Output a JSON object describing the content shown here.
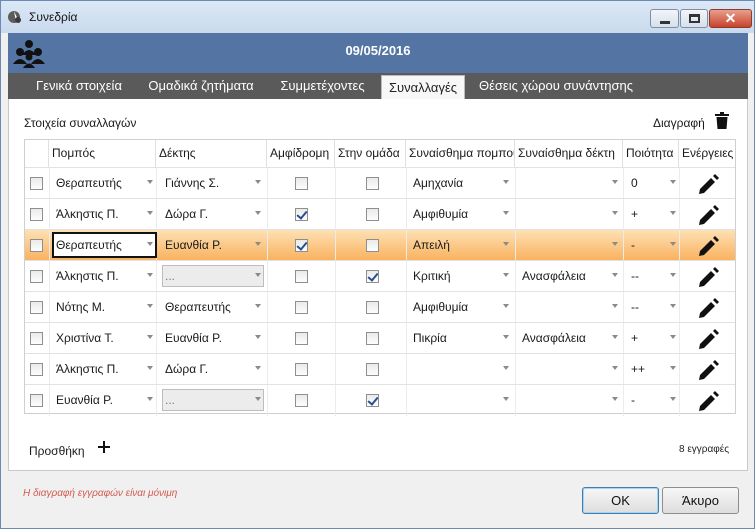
{
  "window": {
    "title": "Συνεδρία"
  },
  "header": {
    "date": "09/05/2016"
  },
  "tabs": [
    {
      "label": "Γενικά στοιχεία",
      "active": false
    },
    {
      "label": "Ομαδικά ζητήματα",
      "active": false
    },
    {
      "label": "Συμμετέχοντες",
      "active": false
    },
    {
      "label": "Συναλλαγές",
      "active": true
    },
    {
      "label": "Θέσεις χώρου συνάντησης",
      "active": false
    }
  ],
  "section": {
    "title": "Στοιχεία συναλλαγών",
    "delete_label": "Διαγραφή"
  },
  "grid": {
    "columns": [
      "Πομπός",
      "Δέκτης",
      "Αμφίδρομη",
      "Στην ομάδα",
      "Συναίσθημα πομπού",
      "Συναίσθημα δέκτη",
      "Ποιότητα",
      "Ενέργειες"
    ],
    "rows": [
      {
        "sender": "Θεραπευτής",
        "receiver": "Γιάννης Σ.",
        "bidirectional": false,
        "in_group": false,
        "sender_emotion": "Αμηχανία",
        "receiver_emotion": "",
        "quality": "0",
        "receiver_disabled": false
      },
      {
        "sender": "Άλκηστις Π.",
        "receiver": "Δώρα Γ.",
        "bidirectional": true,
        "in_group": false,
        "sender_emotion": "Αμφιθυμία",
        "receiver_emotion": "",
        "quality": "+",
        "receiver_disabled": false
      },
      {
        "sender": "Θεραπευτής",
        "receiver": "Ευανθία Ρ.",
        "bidirectional": true,
        "in_group": false,
        "sender_emotion": "Απειλή",
        "receiver_emotion": "",
        "quality": "-",
        "receiver_disabled": false
      },
      {
        "sender": "Άλκηστις Π.",
        "receiver": "...",
        "bidirectional": false,
        "in_group": true,
        "sender_emotion": "Κριτική",
        "receiver_emotion": "Ανασφάλεια",
        "quality": "--",
        "receiver_disabled": true
      },
      {
        "sender": "Νότης Μ.",
        "receiver": "Θεραπευτής",
        "bidirectional": false,
        "in_group": false,
        "sender_emotion": "Αμφιθυμία",
        "receiver_emotion": "",
        "quality": "--",
        "receiver_disabled": false
      },
      {
        "sender": "Χριστίνα Τ.",
        "receiver": "Ευανθία Ρ.",
        "bidirectional": false,
        "in_group": false,
        "sender_emotion": "Πικρία",
        "receiver_emotion": "Ανασφάλεια",
        "quality": "+",
        "receiver_disabled": false
      },
      {
        "sender": "Άλκηστις Π.",
        "receiver": "Δώρα Γ.",
        "bidirectional": false,
        "in_group": false,
        "sender_emotion": "",
        "receiver_emotion": "",
        "quality": "++",
        "receiver_disabled": false
      },
      {
        "sender": "Ευανθία Ρ.",
        "receiver": "...",
        "bidirectional": false,
        "in_group": true,
        "sender_emotion": "",
        "receiver_emotion": "",
        "quality": "-",
        "receiver_disabled": true
      }
    ],
    "selected_row": 2
  },
  "footer": {
    "add_label": "Προσθήκη",
    "record_count": "8 εγγραφές",
    "note": "Η διαγραφή εγγραφών είναι μόνιμη",
    "ok_label": "OK",
    "cancel_label": "Άκυρο"
  },
  "colors": {
    "header_bg": "#5475a4",
    "tabs_bg": "#5a5a5a",
    "selected_row": "#f9b25f",
    "note_color": "#d45a4f"
  },
  "icons": {
    "app": "app-icon",
    "team": "team-icon",
    "trash": "trash-icon",
    "plus": "plus-icon",
    "edit": "pencil-icon"
  }
}
